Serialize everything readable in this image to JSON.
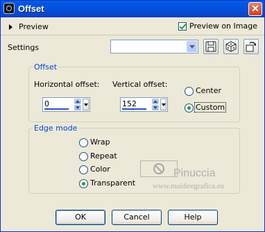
{
  "window": {
    "title": "Offset"
  },
  "header": {
    "preview_toggle_label": "Preview",
    "preview_on_image_label": "Preview on Image",
    "preview_on_image_checked": true
  },
  "settings": {
    "label": "Settings",
    "preset_value": ""
  },
  "offset_group": {
    "title": "Offset",
    "horizontal_label": "Horizontal offset:",
    "horizontal_value": "0",
    "vertical_label": "Vertical offset:",
    "vertical_value": "152",
    "center_label": "Center",
    "custom_label": "Custom",
    "selected": "Custom"
  },
  "edge_group": {
    "title": "Edge mode",
    "options": [
      "Wrap",
      "Repeat",
      "Color",
      "Transparent"
    ],
    "selected": "Transparent"
  },
  "watermark": {
    "line1": "Pinuccia",
    "line2": "www.maidiregrafica.eu"
  },
  "buttons": {
    "ok": "OK",
    "cancel": "Cancel",
    "help": "Help"
  },
  "colors": {
    "title_bar": "#0055e5",
    "dialog_bg": "#ece9d8",
    "group_title": "#0046d5",
    "radio_dot": "#21a121"
  }
}
